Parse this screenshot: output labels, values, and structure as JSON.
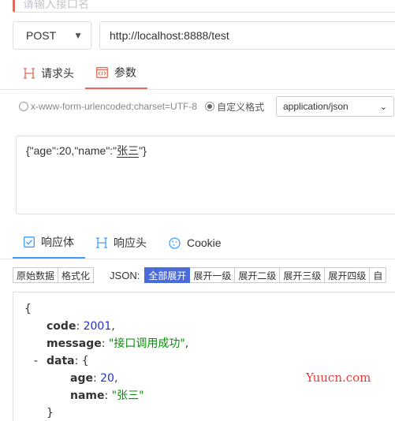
{
  "top": {
    "placeholder": "请输入接口名"
  },
  "request": {
    "method": "POST",
    "url": "http://localhost:8888/test"
  },
  "req_tabs": [
    {
      "label": "请求头",
      "icon": "h-icon"
    },
    {
      "label": "参数",
      "icon": "code-icon"
    }
  ],
  "format": {
    "option_urlencoded": "x-www-form-urlencoded;charset=UTF-8",
    "option_custom": "自定义格式",
    "content_type": "application/json"
  },
  "body": {
    "text_prefix": "{\"age\":20,\"name\":\"",
    "text_name": "张三",
    "text_suffix": "\"}"
  },
  "resp_tabs": [
    {
      "label": "响应体",
      "icon": "checkbox-icon"
    },
    {
      "label": "响应头",
      "icon": "h-icon"
    },
    {
      "label": "Cookie",
      "icon": "cookie-icon"
    }
  ],
  "toolbar": {
    "raw": "原始数据",
    "format": "格式化",
    "json_label": "JSON:",
    "expand_all": "全部展开",
    "level1": "展开一级",
    "level2": "展开二级",
    "level3": "展开三级",
    "level4": "展开四级",
    "more": "自"
  },
  "response": {
    "open_brace": "{",
    "code_key": "code",
    "code_val": "2001",
    "message_key": "message",
    "message_val": "\"接口调用成功\"",
    "data_key": "data",
    "data_open": "{",
    "age_key": "age",
    "age_val": "20",
    "name_key": "name",
    "name_val": "\"张三\"",
    "data_close": "}",
    "collapse_symbol": "-"
  },
  "watermark": "Yuucn.com",
  "colors": {
    "accent_red": "#e06c5a",
    "accent_blue": "#409eff",
    "active_btn": "#4a6bdc"
  }
}
